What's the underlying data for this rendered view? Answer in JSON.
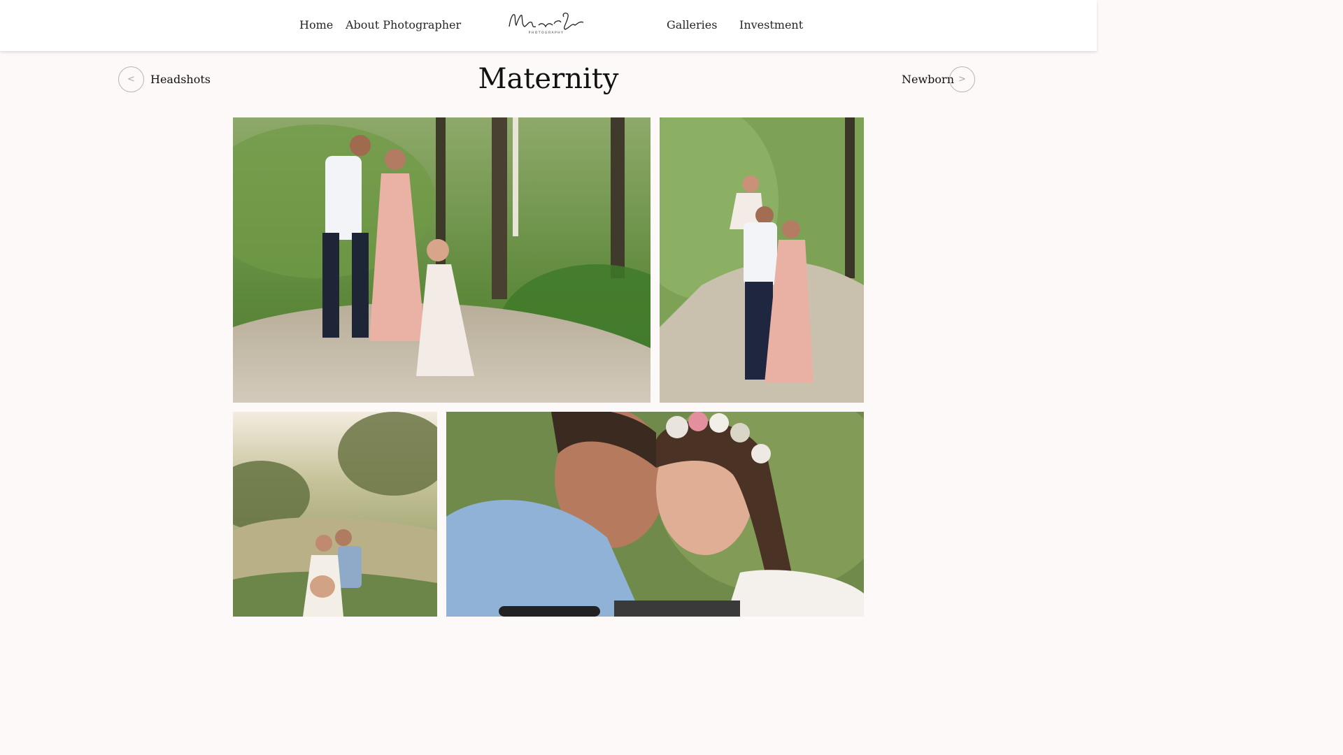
{
  "nav": {
    "home": "Home",
    "about": "About Photographer",
    "galleries": "Galleries",
    "investment": "Investment"
  },
  "logo": {
    "script": "Magnolia Coasts",
    "sub": "PHOTOGRAPHY"
  },
  "gallery": {
    "title": "Maternity",
    "prev_label": "Headshots",
    "prev_icon": "<",
    "next_label": "Newborn",
    "next_icon": ">"
  },
  "colors": {
    "page_bg": "#fdf9f8",
    "nav_bg": "#ffffff",
    "text": "#1e1e1e"
  },
  "photos": [
    {
      "name": "maternity-photo-family-on-forest-path"
    },
    {
      "name": "maternity-photo-father-lifting-daughter"
    },
    {
      "name": "maternity-photo-couple-in-tall-grass"
    },
    {
      "name": "maternity-photo-couple-closeup-with-ultrasound"
    }
  ]
}
